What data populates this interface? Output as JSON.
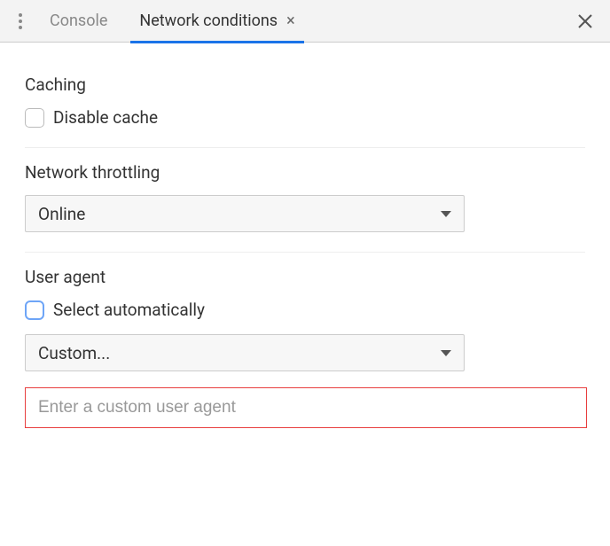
{
  "tabs": {
    "console": "Console",
    "network_conditions": "Network conditions"
  },
  "sections": {
    "caching": {
      "title": "Caching",
      "disable_cache_label": "Disable cache"
    },
    "throttling": {
      "title": "Network throttling",
      "selected": "Online"
    },
    "user_agent": {
      "title": "User agent",
      "select_auto_label": "Select automatically",
      "selected": "Custom...",
      "custom_placeholder": "Enter a custom user agent"
    }
  }
}
